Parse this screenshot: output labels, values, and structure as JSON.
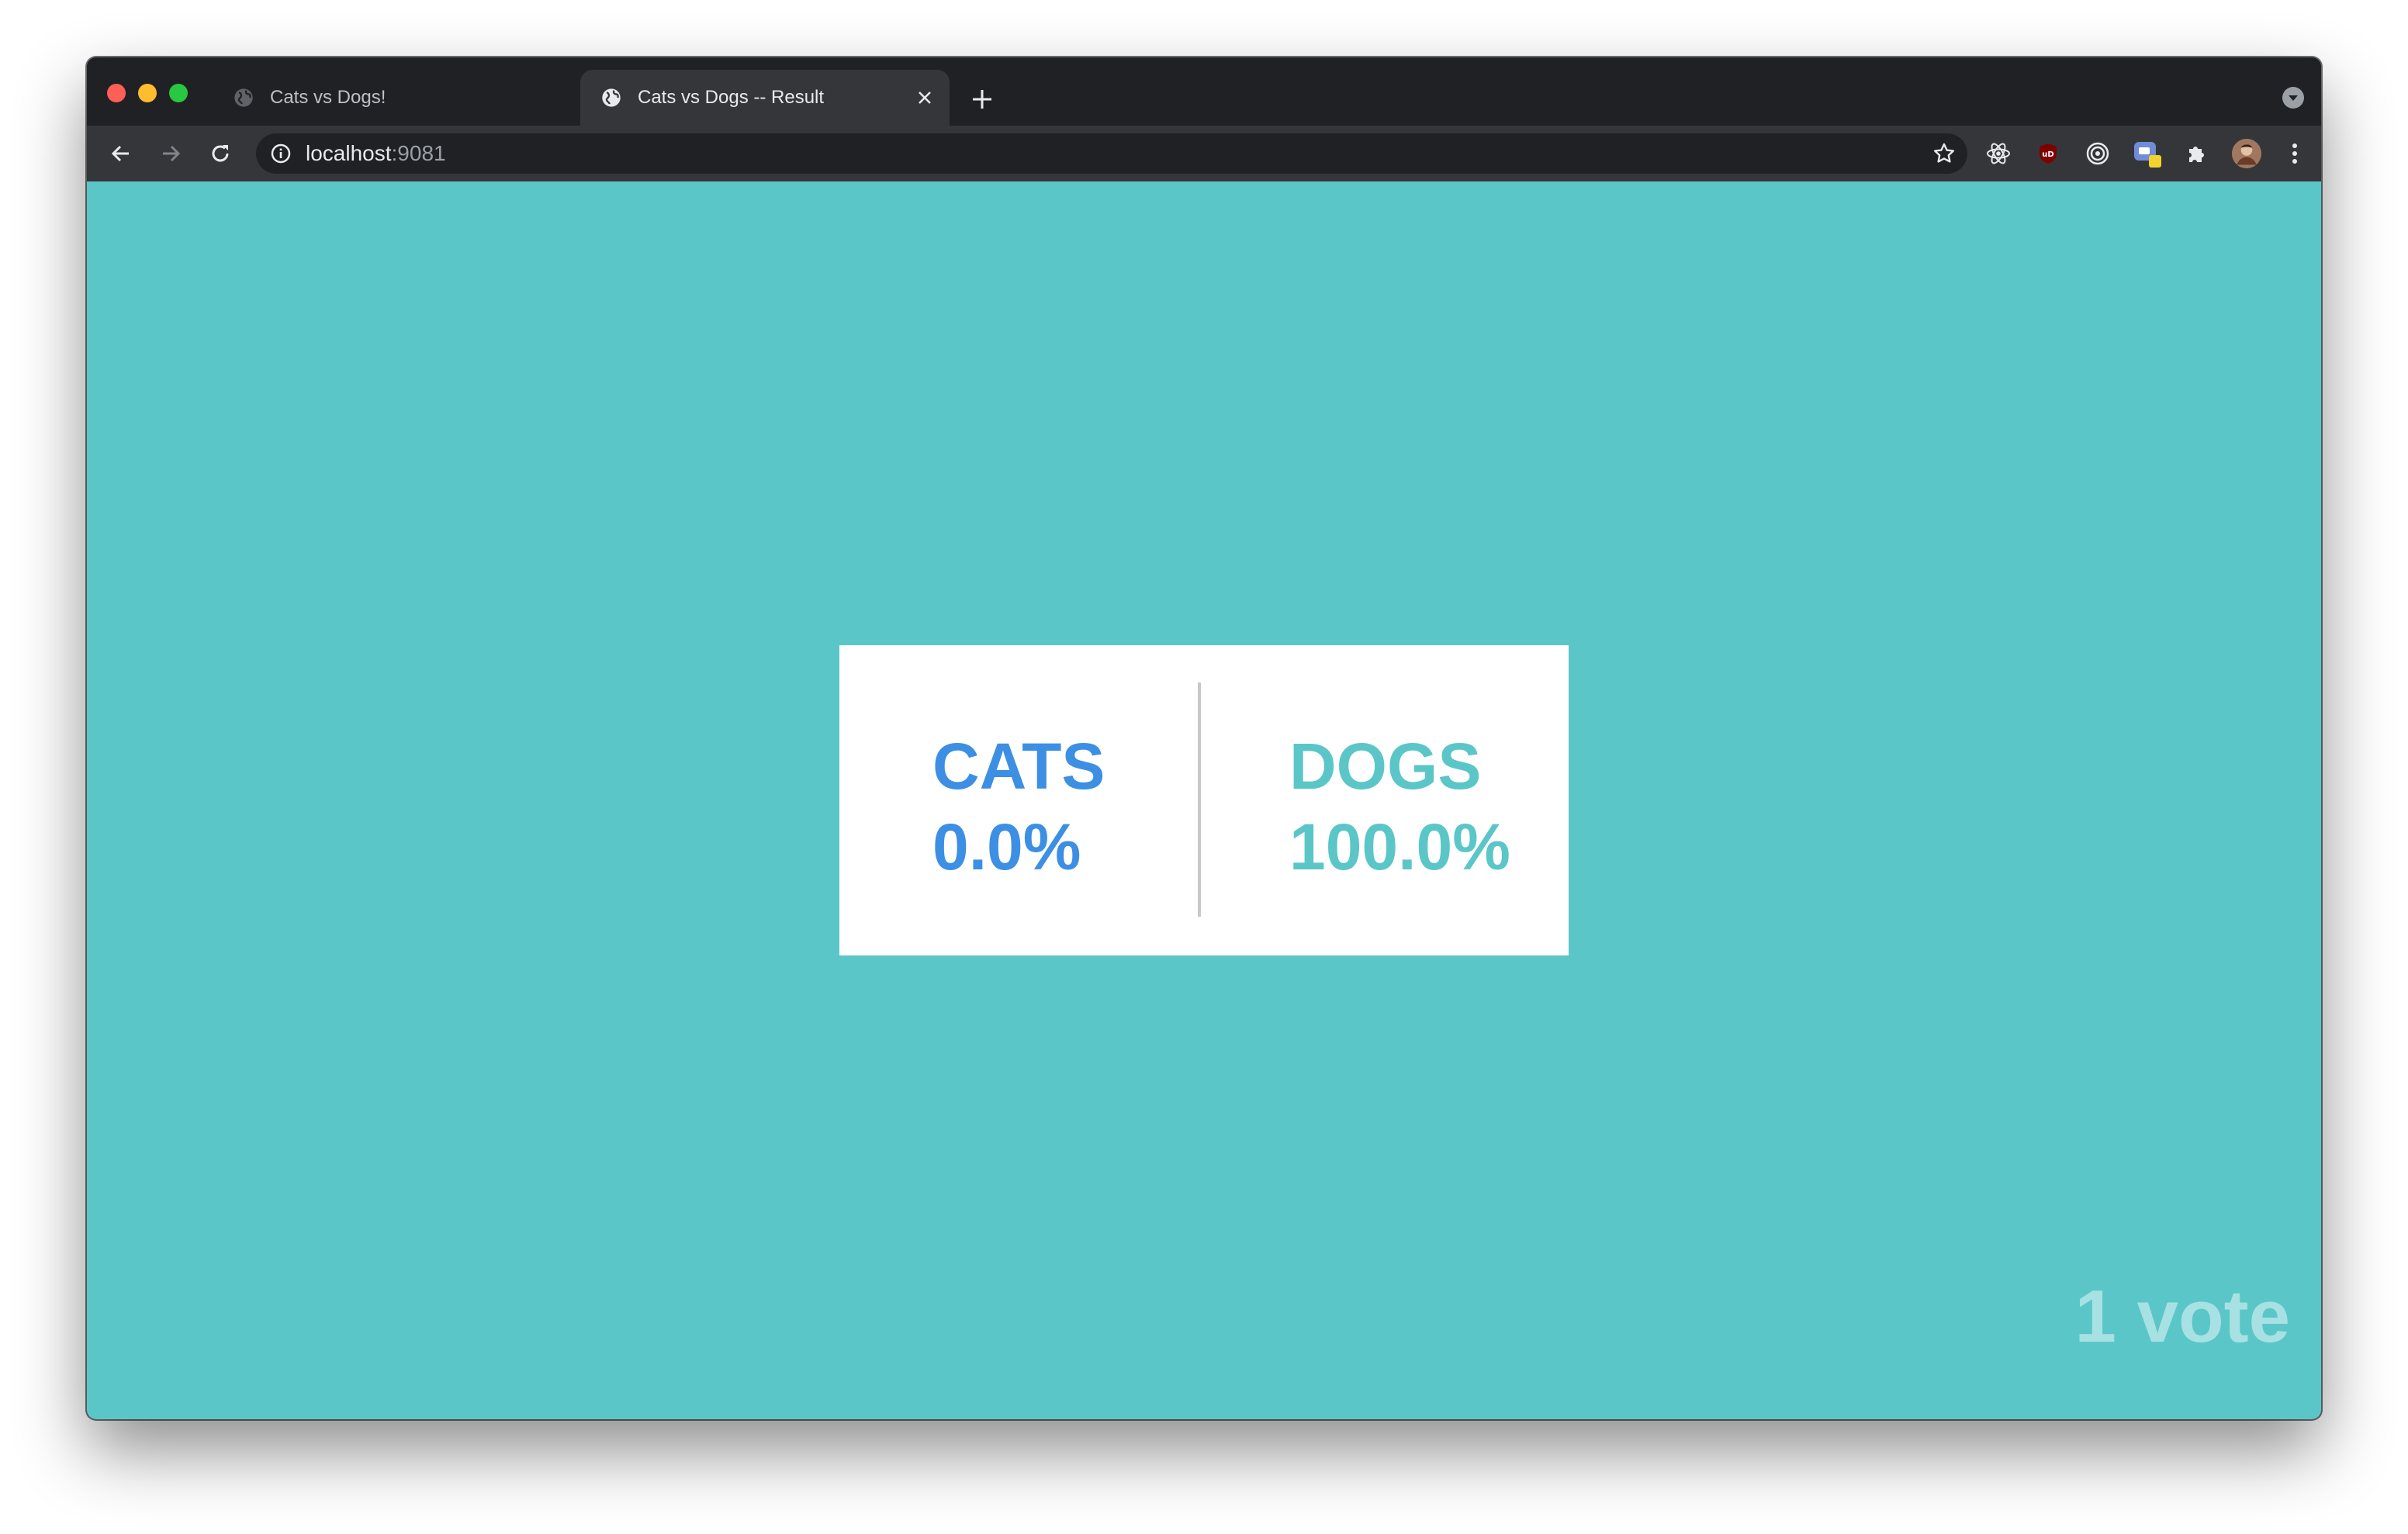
{
  "browser": {
    "tabs": [
      {
        "title": "Cats vs Dogs!",
        "active": false
      },
      {
        "title": "Cats vs Dogs -- Result",
        "active": true
      }
    ],
    "address": {
      "host": "localhost",
      "port": ":9081"
    },
    "icons": {
      "back": "arrow-left-icon",
      "forward": "arrow-right-icon",
      "reload": "reload-icon",
      "info": "info-icon",
      "bookmark": "star-icon",
      "extensions": [
        "react-devtools-icon",
        "ublock-icon",
        "target-icon",
        "gimp-extension-icon",
        "puzzle-icon",
        "profile-avatar",
        "kebab-menu-icon"
      ]
    }
  },
  "results": {
    "option_a": {
      "label": "CATS",
      "percent": "0.0%"
    },
    "option_b": {
      "label": "DOGS",
      "percent": "100.0%"
    },
    "votes": "1 vote"
  },
  "colors": {
    "background": "#5bc6c8",
    "cats": "#3c8fe3",
    "dogs": "#5bc6c8",
    "votes_text": "#a8e1e3"
  }
}
